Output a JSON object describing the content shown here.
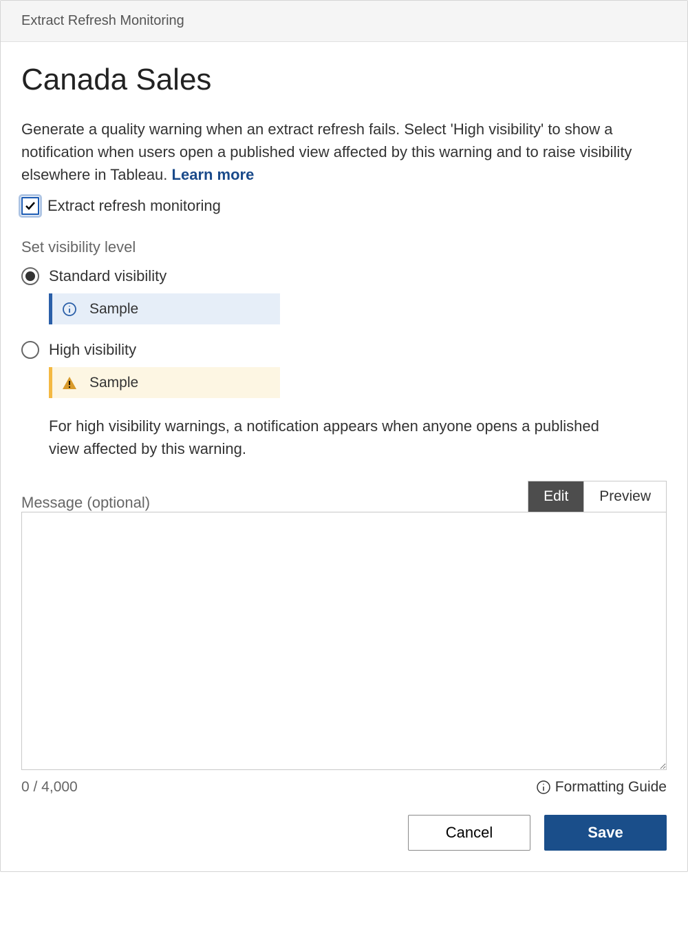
{
  "header": {
    "title": "Extract Refresh Monitoring"
  },
  "main": {
    "title": "Canada Sales",
    "description": "Generate a quality warning when an extract refresh fails. Select 'High visibility' to show a notification when users open a published view affected by this warning and to raise visibility elsewhere in Tableau. ",
    "learn_more": "Learn more"
  },
  "monitoring": {
    "checkbox_label": "Extract refresh monitoring",
    "checked": true
  },
  "visibility": {
    "section_label": "Set visibility level",
    "standard": {
      "label": "Standard visibility",
      "sample": "Sample",
      "selected": true
    },
    "high": {
      "label": "High visibility",
      "sample": "Sample",
      "selected": false,
      "description": "For high visibility warnings, a notification appears when anyone opens a published view affected by this warning."
    }
  },
  "message": {
    "label": "Message (optional)",
    "tabs": {
      "edit": "Edit",
      "preview": "Preview"
    },
    "value": "",
    "char_count": "0 / 4,000",
    "formatting_guide": "Formatting Guide"
  },
  "footer": {
    "cancel": "Cancel",
    "save": "Save"
  }
}
